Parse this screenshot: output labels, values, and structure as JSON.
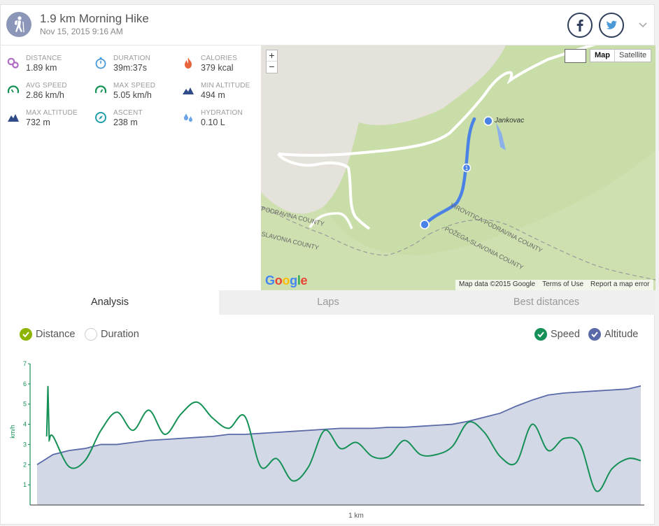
{
  "header": {
    "title": "1.9 km Morning Hike",
    "date": "Nov 15, 2015 9:16 AM",
    "avatar_icon": "hiker-icon",
    "share": [
      "facebook-icon",
      "twitter-icon"
    ]
  },
  "stats": [
    {
      "label": "DISTANCE",
      "value": "1.89 km",
      "icon": "distance-icon",
      "color": "#b06cc4"
    },
    {
      "label": "DURATION",
      "value": "39m:37s",
      "icon": "stopwatch-icon",
      "color": "#4a9ad8"
    },
    {
      "label": "CALORIES",
      "value": "379 kcal",
      "icon": "flame-icon",
      "color": "#e8643c"
    },
    {
      "label": "AVG SPEED",
      "value": "2.86 km/h",
      "icon": "speedometer-icon",
      "color": "#159056"
    },
    {
      "label": "MAX SPEED",
      "value": "5.05 km/h",
      "icon": "speedometer-icon",
      "color": "#159056"
    },
    {
      "label": "MIN ALTITUDE",
      "value": "494 m",
      "icon": "mountain-icon",
      "color": "#2f4b8a"
    },
    {
      "label": "MAX ALTITUDE",
      "value": "732 m",
      "icon": "mountain-icon",
      "color": "#2f4b8a"
    },
    {
      "label": "ASCENT",
      "value": "238 m",
      "icon": "compass-icon",
      "color": "#20a0a8"
    },
    {
      "label": "HYDRATION",
      "value": "0.10 L",
      "icon": "drops-icon",
      "color": "#6aa3e8"
    }
  ],
  "map": {
    "zoom_in": "+",
    "zoom_out": "−",
    "map_type": {
      "map": "Map",
      "satellite": "Satellite"
    },
    "place_label": "Jankovac",
    "county_labels": [
      "PODRAVINA COUNTY",
      "SLAVONIA COUNTY",
      "VIROVITICA-PODRAVINA COUNTY",
      "POŽEGA-SLAVONIA COUNTY"
    ],
    "marker_label": "1",
    "logo": "Google",
    "attribution": [
      "Map data ©2015 Google",
      "Terms of Use",
      "Report a map error"
    ]
  },
  "tabs": [
    {
      "label": "Analysis",
      "active": true
    },
    {
      "label": "Laps",
      "active": false
    },
    {
      "label": "Best distances",
      "active": false
    }
  ],
  "toggles": {
    "x_axis": [
      {
        "label": "Distance",
        "checked": true,
        "color": "#8cb400"
      },
      {
        "label": "Duration",
        "checked": false,
        "color": "#cccccc"
      }
    ],
    "series": [
      {
        "label": "Speed",
        "checked": true,
        "color": "#159056"
      },
      {
        "label": "Altitude",
        "checked": true,
        "color": "#5a6aa8"
      }
    ]
  },
  "chart_data": {
    "type": "line",
    "xlabel": "1 km",
    "ylabel": "km/h",
    "ylim": [
      0,
      7
    ],
    "yticks": [
      1,
      2,
      3,
      4,
      5,
      6,
      7
    ],
    "x": [
      0,
      0.05,
      0.1,
      0.15,
      0.2,
      0.25,
      0.3,
      0.35,
      0.4,
      0.45,
      0.5,
      0.55,
      0.6,
      0.65,
      0.7,
      0.75,
      0.8,
      0.85,
      0.9,
      0.95,
      1.0,
      1.05,
      1.1,
      1.15,
      1.2,
      1.25,
      1.3,
      1.35,
      1.4,
      1.45,
      1.5,
      1.55,
      1.6,
      1.65,
      1.7,
      1.75,
      1.8,
      1.85,
      1.89
    ],
    "series": [
      {
        "name": "Speed",
        "color": "#159056",
        "values": [
          null,
          3.4,
          1.9,
          2.2,
          3.7,
          4.6,
          3.7,
          4.7,
          3.5,
          4.5,
          5.1,
          4.3,
          3.8,
          4.4,
          1.9,
          2.3,
          1.2,
          1.9,
          3.7,
          2.8,
          3.1,
          2.4,
          2.4,
          3.2,
          2.5,
          2.5,
          2.9,
          4.1,
          3.6,
          2.4,
          2.1,
          4.0,
          2.7,
          3.3,
          3.0,
          0.7,
          1.8,
          2.3,
          2.2
        ]
      },
      {
        "name": "Altitude",
        "color": "#5a6aa8",
        "fill": "#d3d8e6",
        "values": [
          2.0,
          2.5,
          2.7,
          2.8,
          3.0,
          3.0,
          3.1,
          3.2,
          3.25,
          3.3,
          3.35,
          3.4,
          3.5,
          3.5,
          3.55,
          3.6,
          3.65,
          3.7,
          3.75,
          3.8,
          3.8,
          3.8,
          3.85,
          3.85,
          3.9,
          3.95,
          4.0,
          4.15,
          4.35,
          4.55,
          4.9,
          5.2,
          5.45,
          5.55,
          5.6,
          5.65,
          5.7,
          5.75,
          5.9
        ]
      }
    ]
  }
}
